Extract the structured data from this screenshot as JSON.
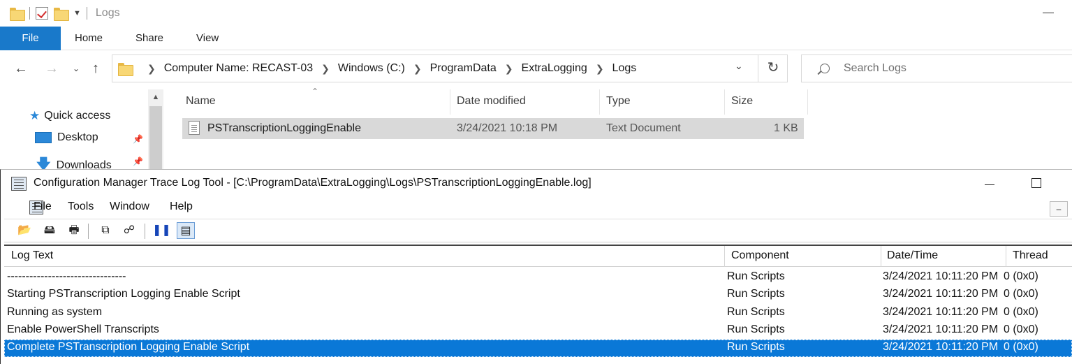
{
  "explorer": {
    "window_title": "Logs",
    "ribbon_tabs": [
      "File",
      "Home",
      "Share",
      "View"
    ],
    "breadcrumb": [
      "Computer Name:  RECAST-03",
      "Windows (C:)",
      "ProgramData",
      "ExtraLogging",
      "Logs"
    ],
    "search_placeholder": "Search Logs",
    "nav": {
      "quick_access": "Quick access",
      "desktop": "Desktop",
      "downloads": "Downloads"
    },
    "columns": [
      "Name",
      "Date modified",
      "Type",
      "Size"
    ],
    "files": [
      {
        "name": "PSTranscriptionLoggingEnable",
        "date": "3/24/2021 10:18 PM",
        "type": "Text Document",
        "size": "1 KB"
      }
    ]
  },
  "cmtrace": {
    "title": "Configuration Manager Trace Log Tool - [C:\\ProgramData\\ExtraLogging\\Logs\\PSTranscriptionLoggingEnable.log]",
    "menu": [
      "File",
      "Tools",
      "Window",
      "Help"
    ],
    "columns": [
      "Log Text",
      "Component",
      "Date/Time",
      "Thread"
    ],
    "rows": [
      {
        "text": "--------------------------------",
        "component": "Run Scripts",
        "datetime": "3/24/2021 10:11:20 PM",
        "thread": "0 (0x0)"
      },
      {
        "text": "Starting PSTranscription Logging Enable Script",
        "component": "Run Scripts",
        "datetime": "3/24/2021 10:11:20 PM",
        "thread": "0 (0x0)"
      },
      {
        "text": "Running as system",
        "component": "Run Scripts",
        "datetime": "3/24/2021 10:11:20 PM",
        "thread": "0 (0x0)"
      },
      {
        "text": "Enable PowerShell Transcripts",
        "component": "Run Scripts",
        "datetime": "3/24/2021 10:11:20 PM",
        "thread": "0 (0x0)"
      },
      {
        "text": "Complete PSTranscription Logging Enable Script",
        "component": "Run Scripts",
        "datetime": "3/24/2021 10:11:20 PM",
        "thread": "0 (0x0)"
      }
    ],
    "selected_row": 4
  },
  "colors": {
    "file_tab": "#1979ca",
    "selection": "#0a78d7",
    "file_row_highlight": "#d9d9d9"
  }
}
